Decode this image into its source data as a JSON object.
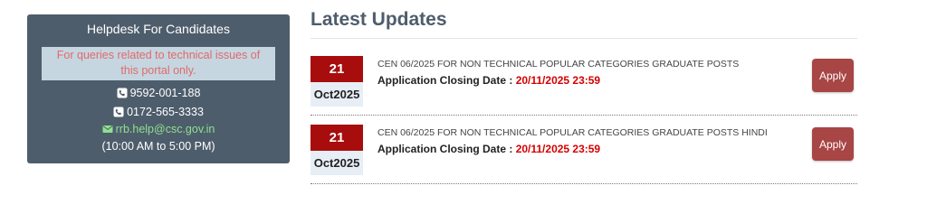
{
  "helpdesk": {
    "title": "Helpdesk For Candidates",
    "notice": "For queries related to technical issues of this portal only.",
    "phone1": "9592-001-188",
    "phone2": "0172-565-3333",
    "email": "rrb.help@csc.gov.in",
    "hours": "(10:00 AM to 5:00 PM)",
    "icons": [
      "phone-icon",
      "phone-icon",
      "envelope-icon"
    ]
  },
  "latest_updates": {
    "title": "Latest Updates",
    "items": [
      {
        "day": "21",
        "month": "Oct2025",
        "post": "CEN 06/2025 FOR NON TECHNICAL POPULAR CATEGORIES GRADUATE POSTS",
        "closing_label": "Application Closing Date :",
        "closing_date": "20/11/2025 23:59",
        "apply_label": "Apply"
      },
      {
        "day": "21",
        "month": "Oct2025",
        "post": "CEN 06/2025 FOR NON TECHNICAL POPULAR CATEGORIES GRADUATE POSTS HINDI",
        "closing_label": "Application Closing Date :",
        "closing_date": "20/11/2025 23:59",
        "apply_label": "Apply"
      }
    ]
  },
  "colors": {
    "panel": "#4e5d6c",
    "date_red": "#a80d0d",
    "closing_red": "#d40000",
    "apply_button": "#a84545",
    "email_green": "#8fe08f"
  }
}
